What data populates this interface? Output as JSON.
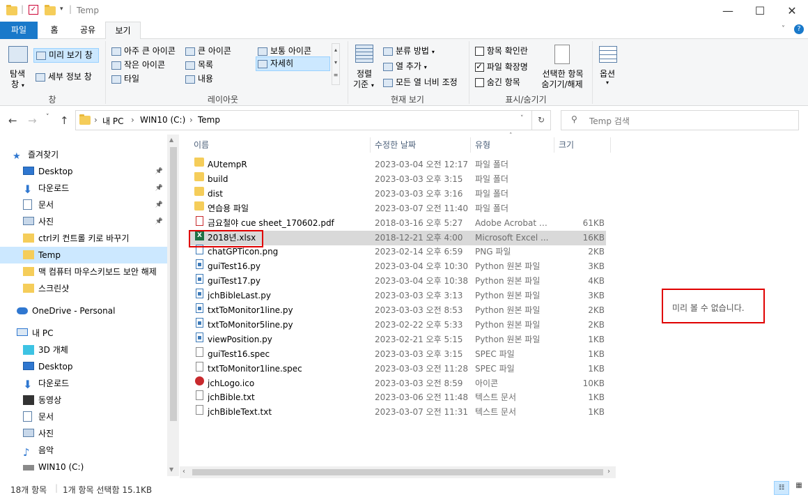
{
  "window": {
    "title": "Temp",
    "minimize": "—",
    "maximize": "☐",
    "close": "✕"
  },
  "tabs": {
    "file": "파일",
    "home": "홈",
    "share": "공유",
    "view": "보기"
  },
  "ribbon": {
    "pane": {
      "nav_pane_label": "탐색",
      "nav_pane_label2": "창",
      "preview_pane": "미리 보기 창",
      "details_pane": "세부 정보 창",
      "group": "창"
    },
    "layout": {
      "extra_large": "아주 큰 아이콘",
      "large": "큰 아이콘",
      "medium": "보통 아이콘",
      "small": "작은 아이콘",
      "list": "목록",
      "details": "자세히",
      "tiles": "타일",
      "content": "내용",
      "group": "레이아웃"
    },
    "current_view": {
      "sort_by": "정렬",
      "sort_by2": "기준",
      "group_by": "분류 방법",
      "add_columns": "열 추가",
      "size_all_columns": "모든 열 너비 조정",
      "group": "현재 보기"
    },
    "show_hide": {
      "item_checkboxes": "항목 확인란",
      "file_extensions": "파일 확장명",
      "hidden_items": "숨긴 항목",
      "hide_selected": "선택한 항목",
      "hide_selected2": "숨기기/해제",
      "group": "표시/숨기기"
    },
    "options": "옵션"
  },
  "address": {
    "breadcrumb": [
      "내 PC",
      "WIN10 (C:)",
      "Temp"
    ],
    "search_placeholder": "Temp 검색"
  },
  "nav": {
    "quick_access": "즐겨찾기",
    "items": [
      {
        "label": "Desktop",
        "pinned": true
      },
      {
        "label": "다운로드",
        "pinned": true
      },
      {
        "label": "문서",
        "pinned": true
      },
      {
        "label": "사진",
        "pinned": true
      },
      {
        "label": "ctrl키 컨트롤 키로 바꾸기",
        "pinned": false
      },
      {
        "label": "Temp",
        "pinned": false
      },
      {
        "label": "맥 컴퓨터 마우스키보드 보안 해제",
        "pinned": false
      },
      {
        "label": "스크린샷",
        "pinned": false
      }
    ],
    "onedrive": "OneDrive - Personal",
    "this_pc": "내 PC",
    "pc_items": [
      "3D 개체",
      "Desktop",
      "다운로드",
      "동영상",
      "문서",
      "사진",
      "음악",
      "WIN10 (C:)"
    ],
    "pin_glyph": "📌"
  },
  "columns": {
    "name": "이름",
    "date": "수정한 날짜",
    "type": "유형",
    "size": "크기"
  },
  "files": [
    {
      "name": "AUtempR",
      "date": "2023-03-04 오전 12:17",
      "type": "파일 폴더",
      "size": "",
      "icon": "folder"
    },
    {
      "name": "build",
      "date": "2023-03-03 오후 3:15",
      "type": "파일 폴더",
      "size": "",
      "icon": "folder"
    },
    {
      "name": "dist",
      "date": "2023-03-03 오후 3:16",
      "type": "파일 폴더",
      "size": "",
      "icon": "folder"
    },
    {
      "name": "연습용 파일",
      "date": "2023-03-07 오전 11:40",
      "type": "파일 폴더",
      "size": "",
      "icon": "folder"
    },
    {
      "name": "금요철야 cue sheet_170602.pdf",
      "date": "2018-03-16 오후 5:27",
      "type": "Adobe Acrobat 문...",
      "size": "61KB",
      "icon": "pdf"
    },
    {
      "name": "2018년.xlsx",
      "date": "2018-12-21 오후 4:00",
      "type": "Microsoft Excel ...",
      "size": "16KB",
      "icon": "xls"
    },
    {
      "name": "chatGPTicon.png",
      "date": "2023-02-14 오후 6:59",
      "type": "PNG 파일",
      "size": "2KB",
      "icon": "png"
    },
    {
      "name": "guiTest16.py",
      "date": "2023-03-04 오후 10:30",
      "type": "Python 원본 파일",
      "size": "3KB",
      "icon": "py"
    },
    {
      "name": "guiTest17.py",
      "date": "2023-03-04 오후 10:38",
      "type": "Python 원본 파일",
      "size": "4KB",
      "icon": "py"
    },
    {
      "name": "jchBibleLast.py",
      "date": "2023-03-03 오후 3:13",
      "type": "Python 원본 파일",
      "size": "3KB",
      "icon": "py"
    },
    {
      "name": "txtToMonitor1line.py",
      "date": "2023-03-03 오전 8:53",
      "type": "Python 원본 파일",
      "size": "2KB",
      "icon": "py"
    },
    {
      "name": "txtToMonitor5line.py",
      "date": "2023-02-22 오후 5:33",
      "type": "Python 원본 파일",
      "size": "2KB",
      "icon": "py"
    },
    {
      "name": "viewPosition.py",
      "date": "2023-02-21 오후 5:15",
      "type": "Python 원본 파일",
      "size": "1KB",
      "icon": "py"
    },
    {
      "name": "guiTest16.spec",
      "date": "2023-03-03 오후 3:15",
      "type": "SPEC 파일",
      "size": "1KB",
      "icon": "doc"
    },
    {
      "name": "txtToMonitor1line.spec",
      "date": "2023-03-03 오전 11:28",
      "type": "SPEC 파일",
      "size": "1KB",
      "icon": "doc"
    },
    {
      "name": "jchLogo.ico",
      "date": "2023-03-03 오전 8:59",
      "type": "아이콘",
      "size": "10KB",
      "icon": "ico"
    },
    {
      "name": "jchBible.txt",
      "date": "2023-03-06 오전 11:48",
      "type": "텍스트 문서",
      "size": "1KB",
      "icon": "doc"
    },
    {
      "name": "jchBibleText.txt",
      "date": "2023-03-07 오전 11:31",
      "type": "텍스트 문서",
      "size": "1KB",
      "icon": "doc"
    }
  ],
  "selected_index": 5,
  "preview": {
    "message": "미리 볼 수 없습니다."
  },
  "status": {
    "count": "18개 항목",
    "selection": "1개 항목 선택함 15.1KB"
  }
}
